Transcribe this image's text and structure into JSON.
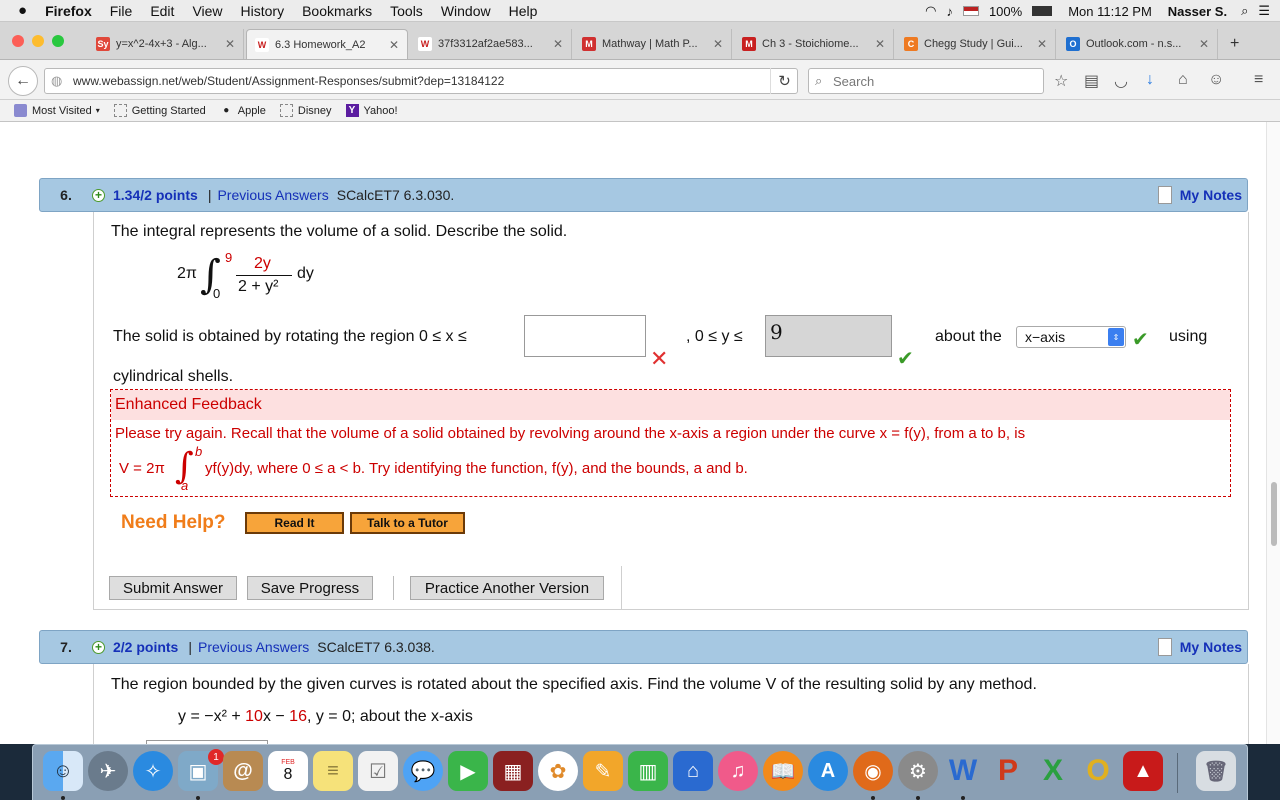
{
  "menubar": {
    "app": "Firefox",
    "items": [
      "File",
      "Edit",
      "View",
      "History",
      "Bookmarks",
      "Tools",
      "Window",
      "Help"
    ],
    "battery": "100%",
    "clock": "Mon 11:12 PM",
    "user": "Nasser S."
  },
  "tabs": [
    {
      "label": "y=x^2-4x+3 - Alg...",
      "icon": "Sy",
      "color": "#e0483a"
    },
    {
      "label": "6.3 Homework_A2",
      "icon": "W",
      "color": "#c82020"
    },
    {
      "label": "37f3312af2ae583...",
      "icon": "W",
      "color": "#c82020"
    },
    {
      "label": "Mathway | Math P...",
      "icon": "M",
      "color": "#d03030"
    },
    {
      "label": "Ch 3 - Stoichiome...",
      "icon": "M",
      "color": "#c82020"
    },
    {
      "label": "Chegg Study | Gui...",
      "icon": "C",
      "color": "#ee7a22"
    },
    {
      "label": "Outlook.com - n.s...",
      "icon": "O",
      "color": "#1f6fd0"
    }
  ],
  "nav": {
    "url": "www.webassign.net/web/Student/Assignment-Responses/submit?dep=13184122",
    "search_placeholder": "Search"
  },
  "bookmarks": [
    "Most Visited",
    "Getting Started",
    "Apple",
    "Disney",
    "Yahoo!"
  ],
  "q6": {
    "num": "6.",
    "points": "1.34/2 points",
    "prev": "Previous Answers",
    "id": "SCalcET7 6.3.030.",
    "notes": "My Notes",
    "prompt": "The integral represents the volume of a solid. Describe the solid.",
    "int_prefix": "2π",
    "int_upper": "9",
    "int_lower": "0",
    "int_num": "2y",
    "int_den": "2 + y²",
    "int_dy": "dy",
    "line1_a": "The solid is obtained by rotating the region 0 ≤ x ≤",
    "line1_b": ", 0 ≤ y ≤",
    "y_bound_value": "9",
    "line1_c": "about the",
    "axis_option": "x−axis",
    "line1_d": "using",
    "line2": "cylindrical shells.",
    "feedback_title": "Enhanced Feedback",
    "feedback_line1": "Please try again. Recall that the volume of a solid obtained by revolving around the x-axis a region under the curve  x = f(y),  from a to b, is",
    "feedback_v": "V = 2π",
    "feedback_b": "b",
    "feedback_a": "a",
    "feedback_expr": "yf(y)dy,  where  0 ≤ a < b.  Try identifying the function,  f(y),  and the bounds, a and b.",
    "need_help": "Need Help?",
    "read_it": "Read It",
    "tutor": "Talk to a Tutor",
    "submit": "Submit Answer",
    "save": "Save Progress",
    "practice": "Practice Another Version"
  },
  "q7": {
    "num": "7.",
    "points": "2/2 points",
    "prev": "Previous Answers",
    "id": "SCalcET7 6.3.038.",
    "notes": "My Notes",
    "prompt": "The region bounded by the given curves is rotated about the specified axis. Find the volume V of the resulting solid by any method.",
    "eq_a": "y = −x² + ",
    "eq_b": "10",
    "eq_c": "x − ",
    "eq_d": "16",
    "eq_e": ",     y = 0;     about the x-axis"
  },
  "dock": {
    "calendar_month": "FEB",
    "calendar_day": "8",
    "badge": "1"
  }
}
